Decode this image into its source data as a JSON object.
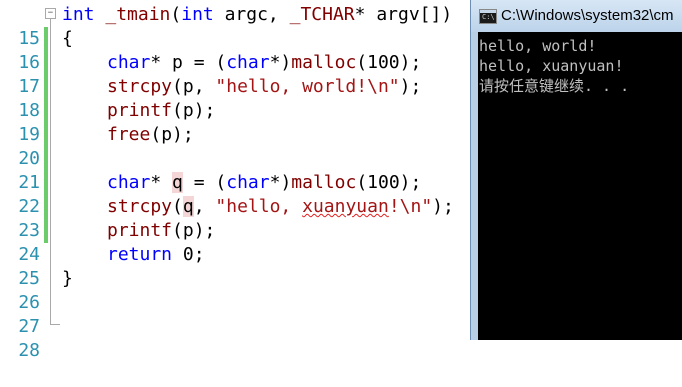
{
  "editor": {
    "lines": [
      {
        "n": "15",
        "text": "int _tmain(int argc, _TCHAR* argv[])"
      },
      {
        "n": "16",
        "text": "{"
      },
      {
        "n": "17",
        "text": "char* p = (char*)malloc(100);"
      },
      {
        "n": "18",
        "text": "strcpy(p, \"hello, world!\\n\");"
      },
      {
        "n": "19",
        "text": "printf(p);"
      },
      {
        "n": "20",
        "text": "free(p);"
      },
      {
        "n": "21",
        "text": ""
      },
      {
        "n": "22",
        "text": "char* q = (char*)malloc(100);"
      },
      {
        "n": "23",
        "text": "strcpy(q, \"hello, xuanyuan!\\n\");"
      },
      {
        "n": "24",
        "text": "printf(p);"
      },
      {
        "n": "25",
        "text": "return 0;"
      },
      {
        "n": "26",
        "text": "}"
      },
      {
        "n": "27",
        "text": ""
      },
      {
        "n": "28",
        "text": ""
      }
    ],
    "tokens": {
      "int": "int",
      "tmain": "_tmain",
      "paren_open": "(",
      "argc": " argc, ",
      "tchar": "_TCHAR",
      "argv": "* argv[])",
      "brace_open": "{",
      "brace_close": "}",
      "char": "char",
      "star_p": "* p = (",
      "star_q": "* ",
      "q": "q",
      "eq_paren": " = (",
      "star_close": "*)",
      "malloc": "malloc",
      "malloc_args": "(100);",
      "strcpy": "strcpy",
      "p_comma": "(p, ",
      "paren": "(",
      "q_ident": "q",
      "comma": ", ",
      "str_world": "\"hello, world!\\n\"",
      "str_hello": "\"hello, ",
      "str_xuanyuan": "xuanyuan",
      "str_tail": "!\\n\"",
      "close_semi": ");",
      "printf": "printf",
      "printf_args": "(p);",
      "free": "free",
      "free_args": "(p);",
      "return": "return",
      "zero": " 0;"
    },
    "colors": {
      "keyword": "#0000ff",
      "function": "#800000",
      "string": "#a31515",
      "line_number": "#2b91af",
      "change_bar": "#6ccc6c"
    }
  },
  "console": {
    "title": "C:\\Windows\\system32\\cm",
    "output": [
      "hello, world!",
      "hello, xuanyuan!",
      "请按任意键继续. . ."
    ],
    "icon": "console-icon"
  }
}
